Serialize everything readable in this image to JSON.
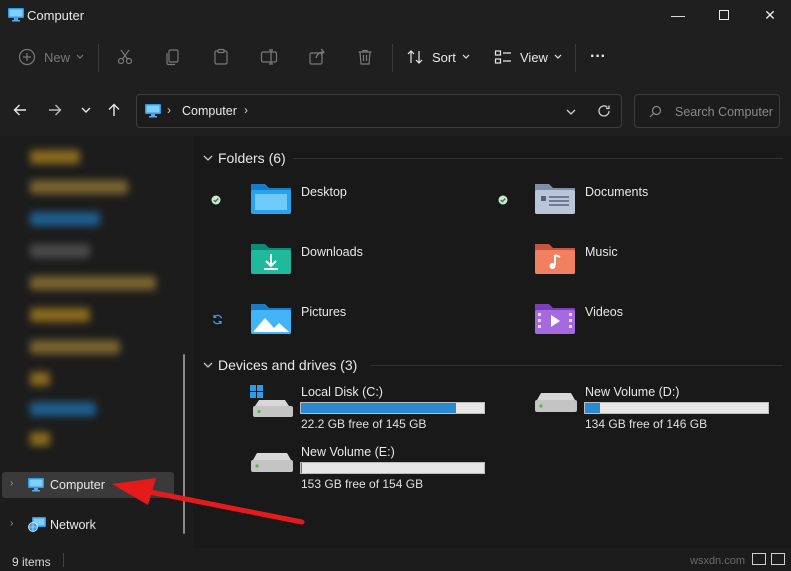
{
  "window": {
    "title": "Computer",
    "minimize_glyph": "—",
    "maximize_glyph": "☐",
    "close_glyph": "✕"
  },
  "toolbar": {
    "new_label": "New",
    "sort_label": "Sort",
    "view_label": "View",
    "more_glyph": "···"
  },
  "address": {
    "path": [
      "Computer"
    ],
    "search_placeholder": "Search Computer"
  },
  "sidebar": {
    "items": [
      {
        "label": "Computer",
        "icon": "computer-icon",
        "selected": true
      },
      {
        "label": "Network",
        "icon": "network-icon",
        "selected": false
      }
    ]
  },
  "main": {
    "folders_header": "Folders (6)",
    "drives_header": "Devices and drives (3)",
    "folders": [
      {
        "label": "Desktop",
        "icon": "desktop-folder-icon",
        "status": "synced-check"
      },
      {
        "label": "Documents",
        "icon": "documents-folder-icon",
        "status": "synced-check"
      },
      {
        "label": "Downloads",
        "icon": "downloads-folder-icon",
        "status": ""
      },
      {
        "label": "Music",
        "icon": "music-folder-icon",
        "status": ""
      },
      {
        "label": "Pictures",
        "icon": "pictures-folder-icon",
        "status": "syncing"
      },
      {
        "label": "Videos",
        "icon": "videos-folder-icon",
        "status": ""
      }
    ],
    "drives": [
      {
        "label": "Local Disk (C:)",
        "free_text": "22.2 GB free of 145 GB",
        "used_fraction": 0.847
      },
      {
        "label": "New Volume (D:)",
        "free_text": "134 GB free of 146 GB",
        "used_fraction": 0.082
      },
      {
        "label": "New Volume (E:)",
        "free_text": "153 GB free of 154 GB",
        "used_fraction": 0.006
      }
    ]
  },
  "status": {
    "items_count": "9 items",
    "watermark": "wsxdn.com"
  },
  "colors": {
    "accent": "#2a8ad4",
    "annotation_arrow": "#e51b1b",
    "background": "#191919"
  }
}
